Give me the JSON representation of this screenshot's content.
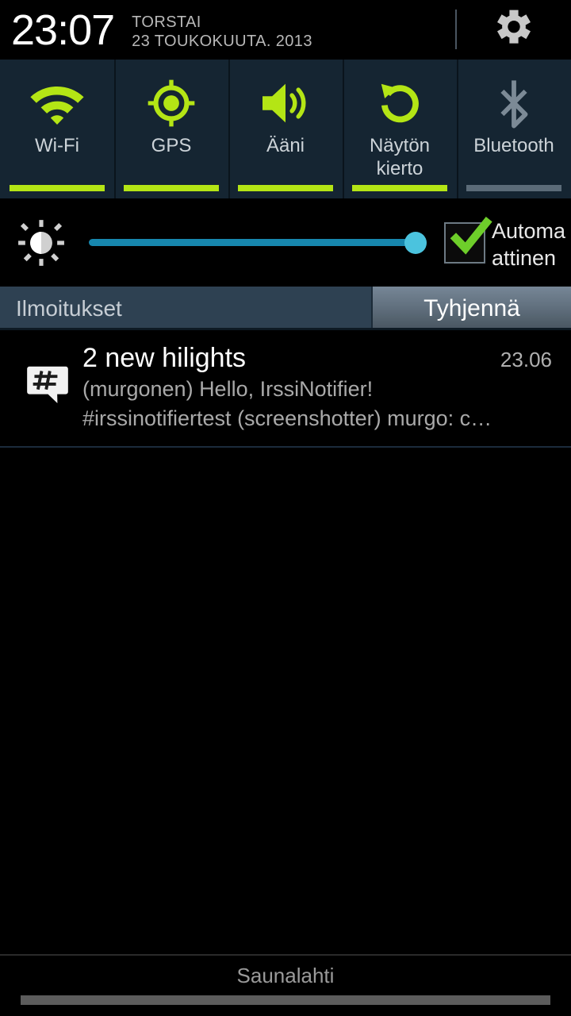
{
  "statusbar": {
    "clock": "23:07",
    "day": "TORSTAI",
    "date": "23 TOUKOKUUTA. 2013",
    "settings_icon": "gear-icon"
  },
  "quick_toggles": [
    {
      "label": "Wi-Fi",
      "icon": "wifi-icon",
      "state": "on"
    },
    {
      "label": "GPS",
      "icon": "gps-icon",
      "state": "on"
    },
    {
      "label": "Ääni",
      "icon": "sound-icon",
      "state": "on"
    },
    {
      "label": "Näytön kierto",
      "icon": "rotate-icon",
      "state": "on"
    },
    {
      "label": "Bluetooth",
      "icon": "bluetooth-icon",
      "state": "off"
    }
  ],
  "brightness": {
    "icon": "brightness-icon",
    "value": 100,
    "auto_label": "Automaattinen",
    "auto_checked": true
  },
  "notifications_panel": {
    "title": "Ilmoitukset",
    "clear_label": "Tyhjennä",
    "items": [
      {
        "icon": "hash-bubble-icon",
        "title": "2 new hilights",
        "time": "23.06",
        "line1": "(murgonen) Hello, IrssiNotifier!",
        "line2": "#irssinotifiertest (screenshotter) murgo: c…"
      }
    ]
  },
  "footer": {
    "carrier": "Saunalahti"
  },
  "colors": {
    "accent_green": "#b4e515",
    "toggle_off_gray": "#5b6b78",
    "panel_bg": "#152532",
    "slider_track": "#1787ae",
    "slider_thumb": "#4bc3de",
    "notif_header_bg": "#2e4152"
  }
}
